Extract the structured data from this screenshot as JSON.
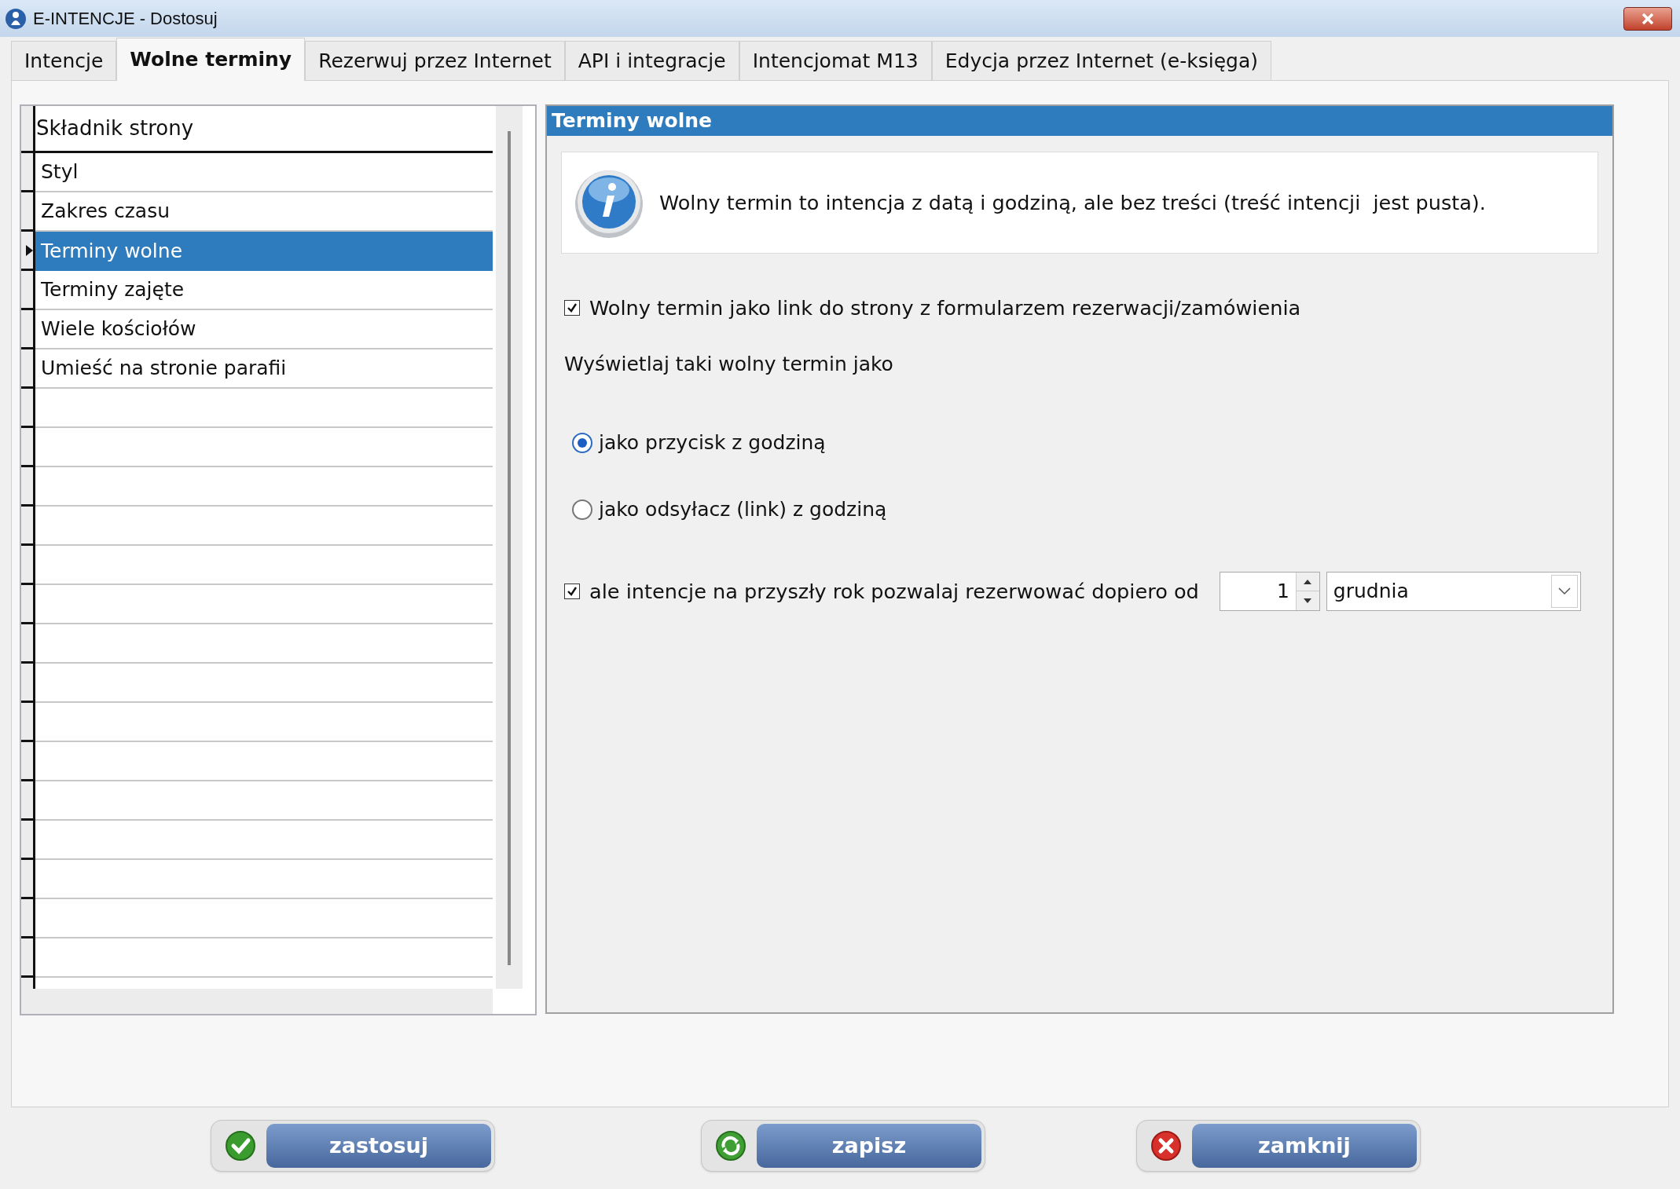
{
  "window": {
    "title": "E-INTENCJE - Dostosuj"
  },
  "tabs": [
    {
      "label": "Intencje",
      "selected": false
    },
    {
      "label": "Wolne terminy",
      "selected": true
    },
    {
      "label": "Rezerwuj przez Internet",
      "selected": false
    },
    {
      "label": "API i integracje",
      "selected": false
    },
    {
      "label": "Intencjomat M13",
      "selected": false
    },
    {
      "label": "Edycja przez Internet (e-księga)",
      "selected": false
    }
  ],
  "grid": {
    "header": "Składnik strony",
    "rows": [
      {
        "label": "Styl",
        "selected": false
      },
      {
        "label": "Zakres czasu",
        "selected": false
      },
      {
        "label": "Terminy wolne",
        "selected": true
      },
      {
        "label": "Terminy zajęte",
        "selected": false
      },
      {
        "label": "Wiele kościołów",
        "selected": false
      },
      {
        "label": "Umieść na stronie parafii",
        "selected": false
      }
    ]
  },
  "panel": {
    "title": "Terminy wolne",
    "info": "Wolny termin to intencja z datą i godziną, ale bez treści (treść intencji  jest pusta).",
    "link_option": {
      "label": "Wolny termin jako link do strony z formularzem rezerwacji/zamówienia",
      "checked": true
    },
    "display_label": "Wyświetlaj taki wolny termin jako",
    "display_options": [
      {
        "label": "jako przycisk z godziną",
        "selected": true
      },
      {
        "label": "jako odsyłacz (link) z godziną",
        "selected": false
      }
    ],
    "reservation": {
      "label": "ale intencje na przyszły rok pozwalaj rezerwować dopiero od",
      "checked": true,
      "day": "1",
      "month": "grudnia"
    }
  },
  "buttons": [
    {
      "label": "zastosuj",
      "kind": "apply"
    },
    {
      "label": "zapisz",
      "kind": "save"
    },
    {
      "label": "zamknij",
      "kind": "close"
    }
  ]
}
